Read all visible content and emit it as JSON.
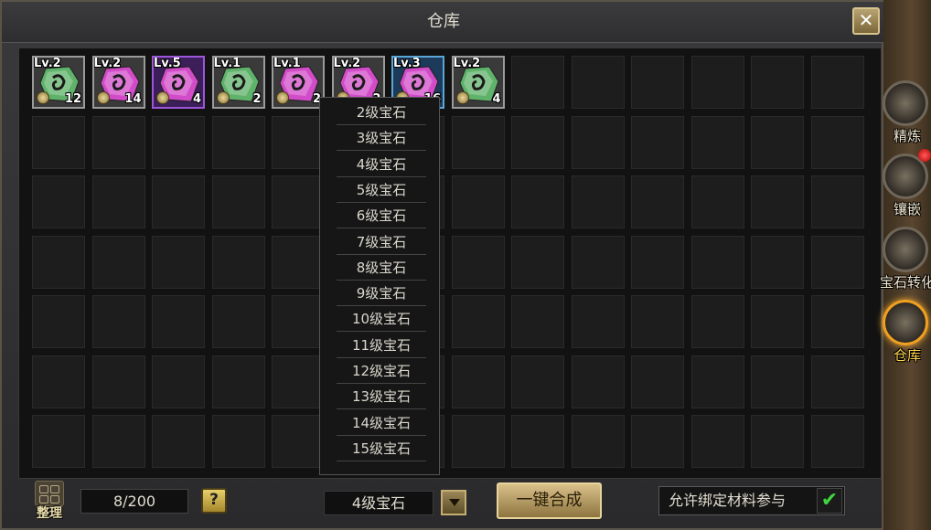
{
  "window": {
    "title": "仓库",
    "close_label": "✕"
  },
  "items": [
    {
      "level": "Lv.2",
      "qty": "12",
      "color": "green",
      "border": "grey"
    },
    {
      "level": "Lv.2",
      "qty": "14",
      "color": "pink",
      "border": "grey"
    },
    {
      "level": "Lv.5",
      "qty": "4",
      "color": "pink",
      "border": "purple"
    },
    {
      "level": "Lv.1",
      "qty": "2",
      "color": "green",
      "border": "grey"
    },
    {
      "level": "Lv.1",
      "qty": "2",
      "color": "pink",
      "border": "grey"
    },
    {
      "level": "Lv.2",
      "qty": "2",
      "color": "pink",
      "border": "grey"
    },
    {
      "level": "Lv.3",
      "qty": "16",
      "color": "pink",
      "border": "blue"
    },
    {
      "level": "Lv.2",
      "qty": "4",
      "color": "green",
      "border": "grey"
    }
  ],
  "dropdown": {
    "options": [
      "2级宝石",
      "3级宝石",
      "4级宝石",
      "5级宝石",
      "6级宝石",
      "7级宝石",
      "8级宝石",
      "9级宝石",
      "10级宝石",
      "11级宝石",
      "12级宝石",
      "13级宝石",
      "14级宝石",
      "15级宝石"
    ],
    "selected": "4级宝石"
  },
  "bottom": {
    "sort_label": "整理",
    "capacity": "8/200",
    "help_label": "?",
    "merge_label": "一键合成",
    "allow_label": "允许绑定材料参与",
    "check_label": "✔"
  },
  "tabs": [
    {
      "label": "精炼",
      "active": false,
      "icon": "anvil-icon"
    },
    {
      "label": "镶嵌",
      "active": false,
      "icon": "star-icon"
    },
    {
      "label": "宝石转化",
      "active": false,
      "icon": "convert-icon"
    },
    {
      "label": "仓库",
      "active": true,
      "icon": "chest-icon"
    }
  ],
  "colors": {
    "gem_green": "#5fb26a",
    "gem_pink": "#d24bc8",
    "active_tab": "#ffd24a"
  }
}
